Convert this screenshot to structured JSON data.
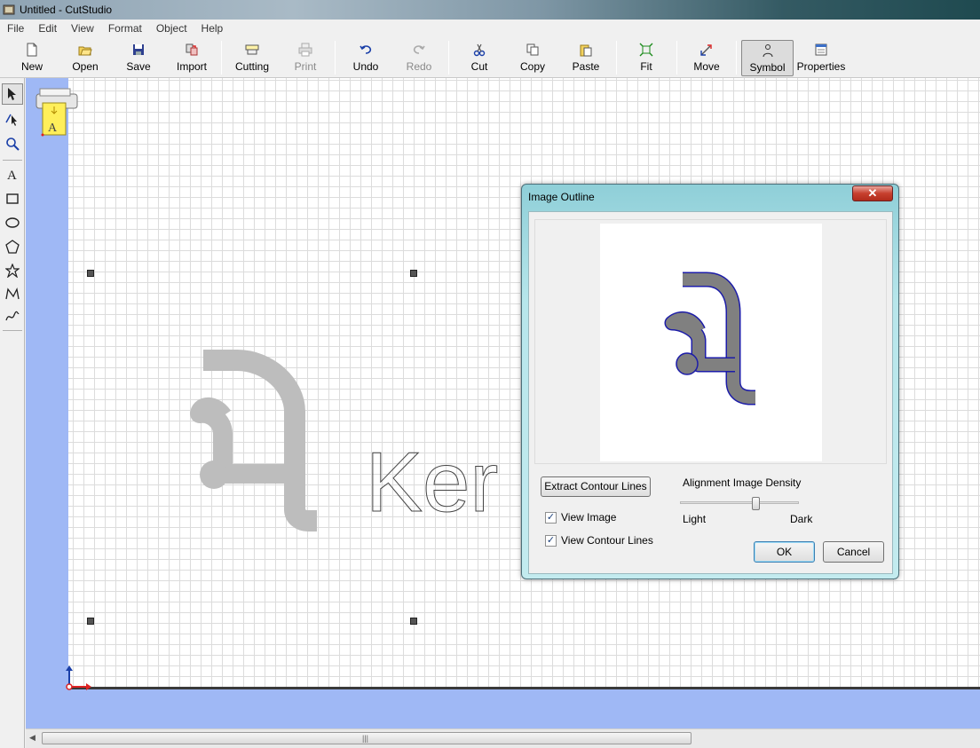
{
  "window": {
    "title": "Untitled - CutStudio"
  },
  "menu": [
    "File",
    "Edit",
    "View",
    "Format",
    "Object",
    "Help"
  ],
  "toolbar": {
    "new": "New",
    "open": "Open",
    "save": "Save",
    "import": "Import",
    "cutting": "Cutting",
    "print": "Print",
    "undo": "Undo",
    "redo": "Redo",
    "cut": "Cut",
    "copy": "Copy",
    "paste": "Paste",
    "fit": "Fit",
    "move": "Move",
    "symbol": "Symbol",
    "properties": "Properties"
  },
  "canvas": {
    "text": "Ker",
    "printer_label": "A"
  },
  "dialog": {
    "title": "Image Outline",
    "close": "✕",
    "extract_button": "Extract Contour Lines",
    "density_label": "Alignment Image Density",
    "light": "Light",
    "dark": "Dark",
    "density_level": 0.65,
    "view_image": "View Image",
    "view_contour": "View Contour Lines",
    "view_image_checked": true,
    "view_contour_checked": true,
    "ok": "OK",
    "cancel": "Cancel"
  },
  "colors": {
    "accent": "#9fb8f5",
    "dialog_frame": "#8fcfd8",
    "outline": "#1c1ca8",
    "shape_fill": "#808080"
  }
}
